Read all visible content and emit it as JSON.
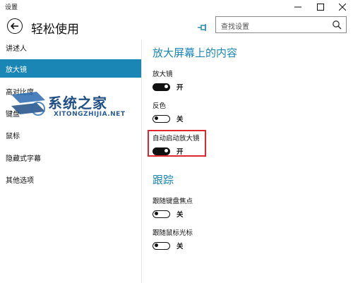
{
  "window": {
    "title": "设置"
  },
  "header": {
    "page_title": "轻松使用",
    "search_placeholder": "查找设置"
  },
  "sidebar": {
    "items": [
      {
        "label": "讲述人"
      },
      {
        "label": "放大镜"
      },
      {
        "label": "高对比度"
      },
      {
        "label": "键盘"
      },
      {
        "label": "鼠标"
      },
      {
        "label": "隐藏式字幕"
      },
      {
        "label": "其他选项"
      }
    ],
    "active_index": 1
  },
  "watermark": {
    "cn": "系统之家",
    "en": "XITONGZHIJIA.NET"
  },
  "content": {
    "section1": {
      "heading": "放大屏幕上的内容",
      "settings": [
        {
          "label": "放大镜",
          "state": "开",
          "on": true
        },
        {
          "label": "反色",
          "state": "关",
          "on": false
        },
        {
          "label": "自动启动放大镜",
          "state": "开",
          "on": true
        }
      ]
    },
    "section2": {
      "heading": "跟踪",
      "settings": [
        {
          "label": "跟随键盘焦点",
          "state": "关",
          "on": false
        },
        {
          "label": "跟随鼠标光标",
          "state": "关",
          "on": false
        }
      ]
    }
  },
  "colors": {
    "accent": "#1a86b5",
    "highlight_box": "#e0262e",
    "watermark": "#1f4f86"
  }
}
